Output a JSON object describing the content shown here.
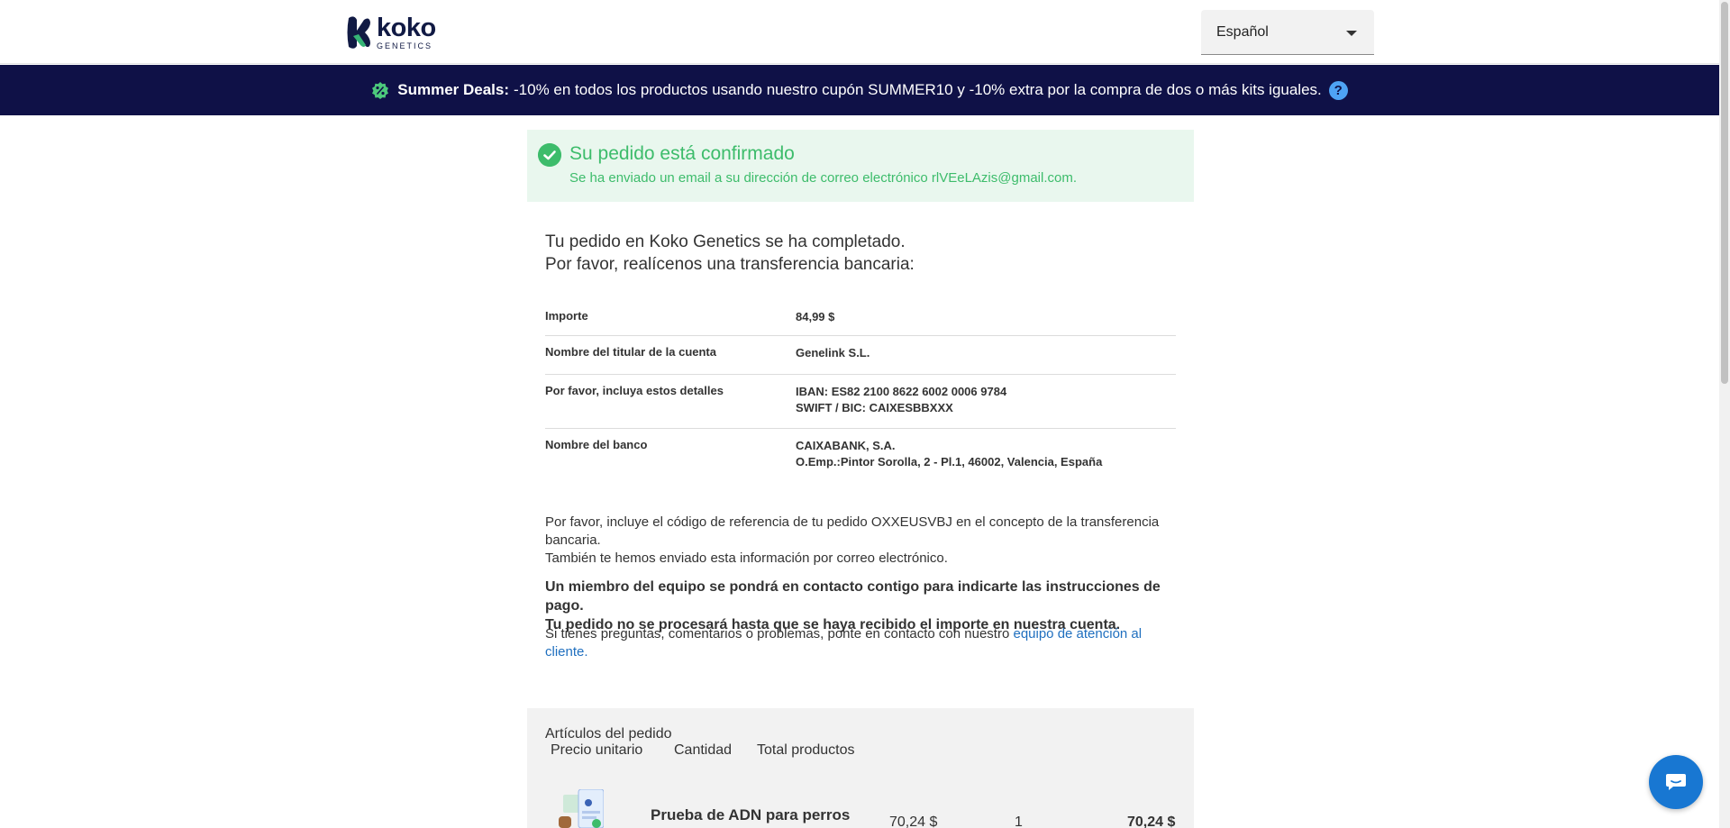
{
  "header": {
    "logo_word": "koko",
    "logo_sub": "GENETICS",
    "language": "Español"
  },
  "promo": {
    "bold": "Summer Deals:",
    "text": "-10% en todos los productos usando nuestro cupón SUMMER10 y -10% extra por la compra de dos o más kits iguales.",
    "help": "?"
  },
  "confirmation": {
    "title": "Su pedido está confirmado",
    "subtitle": "Se ha enviado un email a su dirección de correo electrónico rlVEeLAzis@gmail.com."
  },
  "intro": {
    "line1": "Tu pedido en Koko Genetics se ha completado.",
    "line2": "Por favor, realícenos una transferencia bancaria:"
  },
  "bank_details": [
    {
      "label": "Importe",
      "value_lines": [
        "84,99 $"
      ]
    },
    {
      "label": "Nombre del titular de la cuenta",
      "value_lines": [
        "Genelink S.L."
      ]
    },
    {
      "label": "Por favor, incluya estos detalles",
      "value_lines": [
        "IBAN: ES82 2100 8622 6002 0006 9784",
        "SWIFT / BIC: CAIXESBBXXX"
      ]
    },
    {
      "label": "Nombre del banco",
      "value_lines": [
        "CAIXABANK, S.A.",
        "O.Emp.:Pintor Sorolla, 2 - Pl.1, 46002, Valencia, España"
      ]
    }
  ],
  "notes": {
    "reference": "Por favor, incluye el código de referencia de tu pedido OXXEUSVBJ en el concepto de la transferencia bancaria.",
    "emailed": "También te hemos enviado esta información por correo electrónico.",
    "bold_line1": "Un miembro del equipo se pondrá en contacto contigo para indicarte las instrucciones de pago.",
    "bold_line2": "Tu pedido no se procesará hasta que se haya recibido el importe en nuestra cuenta.",
    "contact_prefix": "Si tienes preguntas, comentarios o problemas, ponte en contacto con nuestro ",
    "contact_link": "equipo de atención al cliente."
  },
  "order": {
    "title": "Artículos del pedido",
    "col_unit_price": "Precio unitario",
    "col_quantity": "Cantidad",
    "col_total": "Total productos",
    "items": [
      {
        "name": "Prueba de ADN para perros",
        "unit_price": "70,24 $",
        "quantity": "1",
        "total": "70,24 $"
      }
    ]
  },
  "colors": {
    "navy": "#0f1147",
    "success_green": "#3dbc6b",
    "success_bg": "#e9f7ee",
    "link_blue": "#1f6fbf",
    "chat_blue": "#1877d2"
  },
  "icons": [
    "koko-logo-icon",
    "chevron-down-icon",
    "discount-badge-icon",
    "help-icon",
    "check-circle-icon",
    "chat-icon"
  ]
}
